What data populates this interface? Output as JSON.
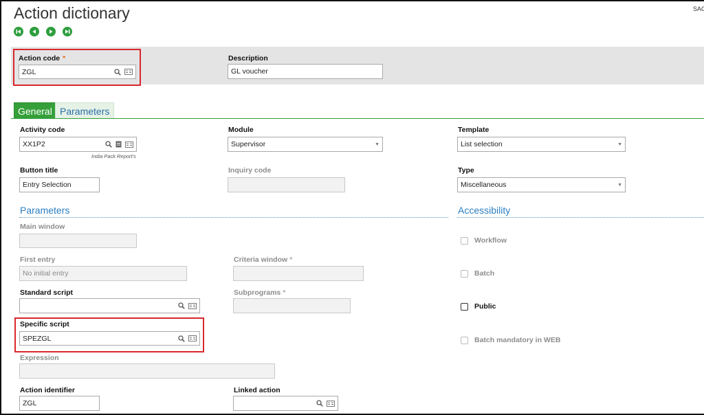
{
  "window": {
    "title": "Action dictionary",
    "corner_text": "SAG"
  },
  "nav": {
    "first_label": "First",
    "previous_label": "Previous",
    "next_label": "Next",
    "last_label": "Last"
  },
  "header": {
    "action_code": {
      "label": "Action code",
      "required_mark": "*",
      "value": "ZGL"
    },
    "description": {
      "label": "Description",
      "value": "GL voucher"
    }
  },
  "tabs": [
    {
      "label": "General",
      "active": true
    },
    {
      "label": "Parameters",
      "active": false
    }
  ],
  "general": {
    "activity_code": {
      "label": "Activity code",
      "value": "XX1P2",
      "caption": "India Pack Report's"
    },
    "module": {
      "label": "Module",
      "value": "Supervisor"
    },
    "template": {
      "label": "Template",
      "value": "List selection"
    },
    "button_title": {
      "label": "Button title",
      "value": "Entry Selection"
    },
    "inquiry_code": {
      "label": "Inquiry code",
      "value": ""
    },
    "type": {
      "label": "Type",
      "value": "Miscellaneous"
    }
  },
  "parameters_section": {
    "title": "Parameters",
    "main_window": {
      "label": "Main window",
      "value": ""
    },
    "first_entry": {
      "label": "First entry",
      "value": "No initial entry"
    },
    "criteria_window": {
      "label": "Criteria window",
      "star": "*",
      "value": ""
    },
    "standard_script": {
      "label": "Standard script",
      "value": ""
    },
    "subprograms": {
      "label": "Subprograms",
      "star": "*",
      "value": ""
    },
    "specific_script": {
      "label": "Specific script",
      "value": "SPEZGL"
    },
    "expression": {
      "label": "Expression",
      "value": ""
    },
    "action_identifier": {
      "label": "Action identifier",
      "value": "ZGL"
    },
    "linked_action": {
      "label": "Linked action",
      "value": ""
    }
  },
  "accessibility_section": {
    "title": "Accessibility",
    "workflow": {
      "label": "Workflow",
      "checked": false,
      "enabled": false
    },
    "batch": {
      "label": "Batch",
      "checked": false,
      "enabled": false
    },
    "public": {
      "label": "Public",
      "checked": false,
      "enabled": true
    },
    "batch_mandatory_web": {
      "label": "Batch mandatory in WEB",
      "checked": false,
      "enabled": false
    }
  },
  "colors": {
    "accent_green": "#35a039",
    "link_blue": "#2b7fc2",
    "highlight_red": "#d9262c",
    "required_orange": "#e0701c"
  },
  "icons": [
    "first-record-icon",
    "previous-record-icon",
    "next-record-icon",
    "last-record-icon",
    "search-icon",
    "selection-list-icon",
    "document-icon",
    "dropdown-arrow-icon",
    "checkbox-icon"
  ]
}
